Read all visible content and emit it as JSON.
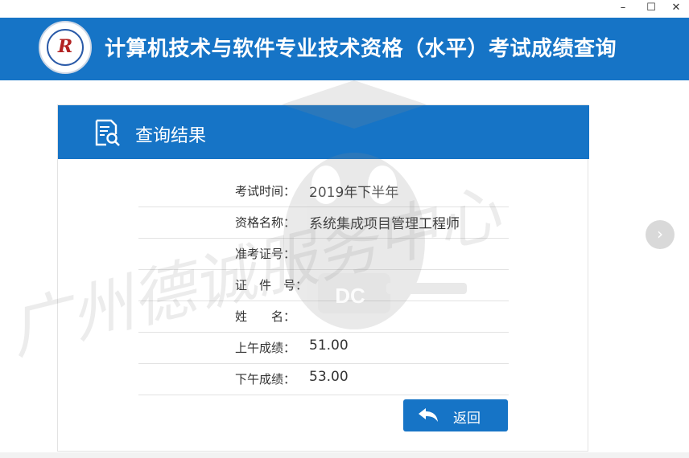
{
  "window": {
    "min_glyph": "–",
    "max_glyph": "☐",
    "close_glyph": "✕"
  },
  "header": {
    "title": "计算机技术与软件专业技术资格（水平）考试成绩查询",
    "logo_letter": "R",
    "logo_icon": "exam-org-seal-icon"
  },
  "card": {
    "title": "查询结果",
    "icon": "search-document-icon"
  },
  "results": [
    {
      "label": "考试时间：",
      "value": "2019年下半年"
    },
    {
      "label": "资格名称：",
      "value": "系统集成项目管理工程师"
    },
    {
      "label": "准考证号：",
      "value": ""
    },
    {
      "label": "证　件　号：",
      "value": ""
    },
    {
      "label": "姓　　名：",
      "value": ""
    },
    {
      "label": "上午成绩：",
      "value": "51.00"
    },
    {
      "label": "下午成绩：",
      "value": "53.00"
    }
  ],
  "actions": {
    "back_label": "返回",
    "back_icon": "return-arrow-icon",
    "next_glyph": "›",
    "next_icon": "chevron-right-icon"
  },
  "watermark": {
    "text": "广州德诚服务中心",
    "mascot_text": "DC"
  },
  "colors": {
    "brand_blue": "#1674c6",
    "watermark_gray": "#8c8c8c"
  }
}
